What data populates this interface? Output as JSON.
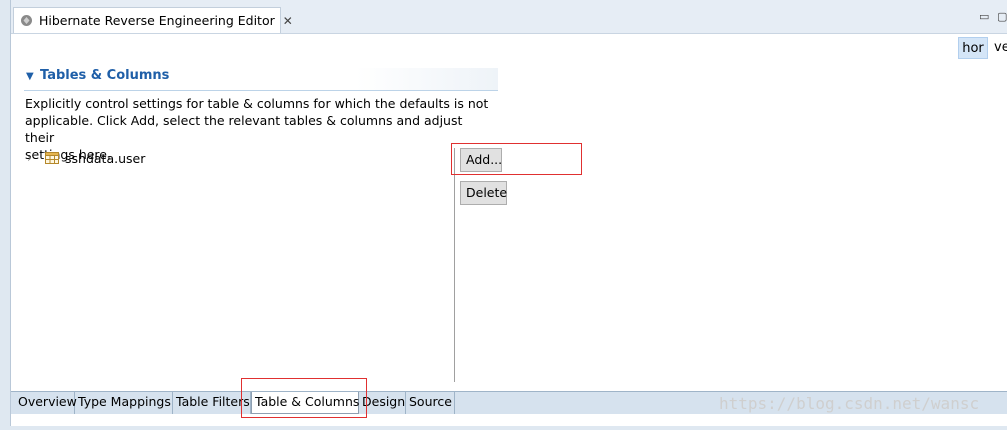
{
  "editor": {
    "title": "Hibernate Reverse Engineering Editor",
    "close_glyph": "✕"
  },
  "window_controls": {
    "minimize_glyph": "▭",
    "maximize_glyph": "▢"
  },
  "orientation": {
    "hor_label": "hor",
    "ver_label": "ve"
  },
  "section": {
    "title": "Tables & Columns",
    "description": "Explicitly control settings for table & columns for which the defaults is not\napplicable. Click Add, select the relevant tables & columns and adjust their\nsettings here."
  },
  "tree": {
    "items": [
      {
        "label": "sshdata.user",
        "icon": "table-icon",
        "expand_glyph": "›"
      }
    ]
  },
  "buttons": {
    "add_label": "Add...",
    "delete_label": "Delete"
  },
  "page_tabs": [
    {
      "label": "Overview",
      "active": false
    },
    {
      "label": "Type Mappings",
      "active": false
    },
    {
      "label": "Table Filters",
      "active": false
    },
    {
      "label": "Table & Columns",
      "active": true
    },
    {
      "label": "Design",
      "active": false
    },
    {
      "label": "Source",
      "active": false
    }
  ],
  "watermark": "https://blog.csdn.net/wansc",
  "colors": {
    "section_title": "#1f5fa8",
    "highlight_box": "#e03030",
    "selected_toggle": "#d4e5f7"
  }
}
